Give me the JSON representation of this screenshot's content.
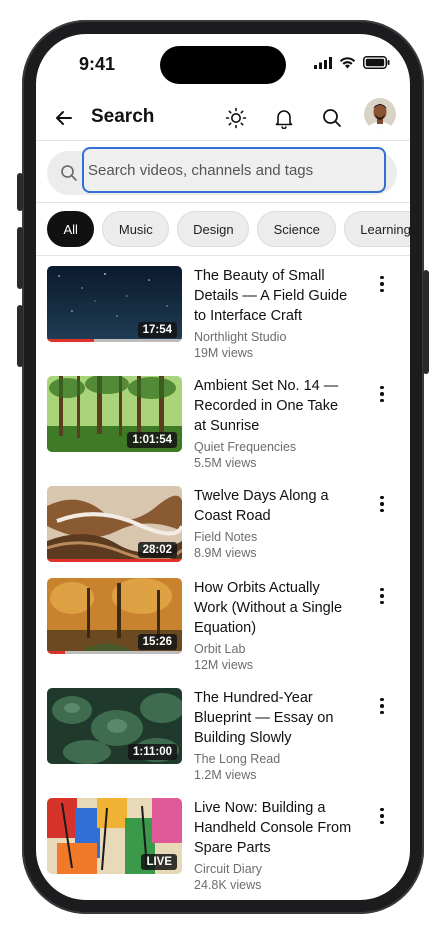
{
  "status_bar": {
    "time": "9:41"
  },
  "header": {
    "title": "Search"
  },
  "search": {
    "placeholder": "Search videos, channels and tags"
  },
  "chips": [
    {
      "label": "All",
      "active": true
    },
    {
      "label": "Music",
      "active": false
    },
    {
      "label": "Design",
      "active": false
    },
    {
      "label": "Science",
      "active": false
    },
    {
      "label": "Learning",
      "active": false
    }
  ],
  "videos": [
    {
      "title": "The Beauty of Small Details — A Field Guide to Interface Craft",
      "channel": "Northlight Studio",
      "views": "19M views",
      "duration": "17:54",
      "progress": 0.35,
      "thumb": "night-sky"
    },
    {
      "title": "Ambient Set No. 14 — Recorded in One Take at Sunrise",
      "channel": "Quiet Frequencies",
      "views": "5.5M views",
      "duration": "1:01:54",
      "progress": 0,
      "thumb": "forest"
    },
    {
      "title": "Twelve Days Along a Coast Road",
      "channel": "Field Notes",
      "views": "8.9M views",
      "duration": "28:02",
      "progress": 1.0,
      "thumb": "marble"
    },
    {
      "title": "How Orbits Actually Work (Without a Single Equation)",
      "channel": "Orbit Lab",
      "views": "12M views",
      "duration": "15:26",
      "progress": 0.13,
      "thumb": "autumn"
    },
    {
      "title": "The Hundred-Year Blueprint — Essay on Building Slowly",
      "channel": "The Long Read",
      "views": "1.2M views",
      "duration": "1:11:00",
      "progress": 0,
      "thumb": "pine"
    },
    {
      "title": "Live Now: Building a Handheld Console From Spare Parts",
      "channel": "Circuit Diary",
      "views": "24.8K views",
      "duration": "LIVE",
      "progress": 0,
      "thumb": "paint"
    }
  ],
  "colors": {
    "accent": "#2f6fd6",
    "progress": "#e0322b",
    "chip_active": "#111111"
  }
}
